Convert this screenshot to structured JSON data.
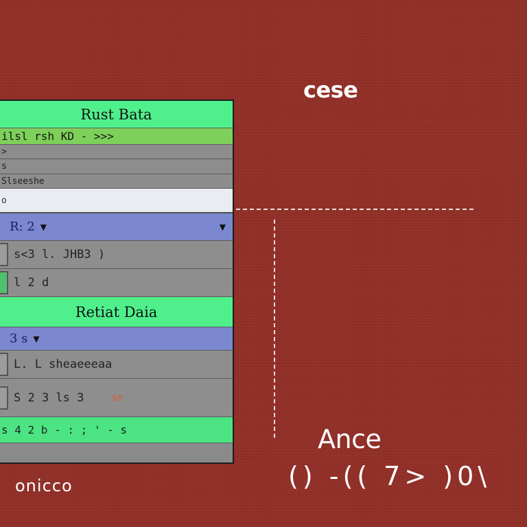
{
  "panel": {
    "title": "Rust Bata",
    "subheader": "ilsl rsh  KD -  >>>",
    "gray_rows": [
      ">",
      "s",
      "Slseeshe"
    ],
    "input_value": "o",
    "dropdown1": {
      "value": "R: 2"
    },
    "data_rows_1": [
      {
        "text": "s<3  l.  JHB3  )"
      },
      {
        "text": "l 2 d"
      }
    ],
    "section_title": "Retiat Daia",
    "dropdown2": {
      "value": "3 s"
    },
    "data_rows_2": [
      {
        "text": "L. L sheaeeeaa"
      },
      {
        "text": "S 2 3  ls 3",
        "tag": "se"
      }
    ],
    "footer": "s 4 2 b  -  :  ;  '  - s"
  },
  "headings": {
    "top": "cese",
    "bottom": "Ance"
  },
  "glyph_row": "() -(( 7> )0\\",
  "caption": "onicco",
  "colors": {
    "background": "#8f2e26",
    "accent_green": "#4ff08c",
    "dropdown_blue": "#7b88cf"
  }
}
